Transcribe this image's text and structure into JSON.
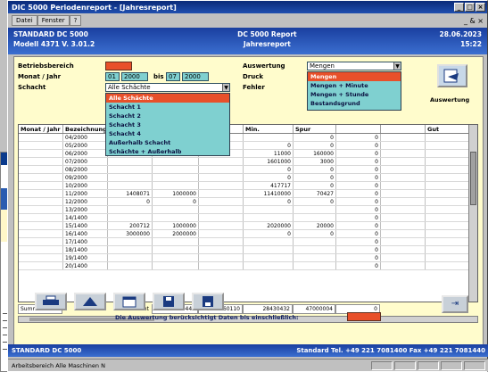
{
  "window": {
    "title": "DIC 5000 Periodenreport - [Jahresreport]",
    "controls": [
      "_",
      "□",
      "×"
    ]
  },
  "menu": {
    "items": [
      "Datei",
      "Fenster",
      "?"
    ],
    "right_label": "_ & ×"
  },
  "header": {
    "left_line1": "STANDARD DC 5000",
    "left_line2": "Modell 4371 V. 3.01.2",
    "center_line1": "DC 5000 Report",
    "center_line2": "Jahresreport",
    "right_line1": "28.06.2023",
    "right_line2": "15:22"
  },
  "form": {
    "label_betriebsbereich": "Betriebsbereich",
    "label_monat_jahr": "Monat / Jahr",
    "monat_von": "01",
    "jahr_von": "2000",
    "label_bis": "bis",
    "monat_bis": "07",
    "jahr_bis": "2000",
    "label_schacht": "Schacht",
    "schacht_value": "Alle Schächte",
    "label_auswertung": "Auswertung",
    "auswertung_value": "Mengen",
    "label_druck": "Druck",
    "label_fehler": "Fehler",
    "auswertung_button_label": "Auswertung"
  },
  "schacht_dropdown": {
    "options": [
      "Alle Schächte",
      "Schacht 1",
      "Schacht 2",
      "Schacht 3",
      "Schacht 4",
      "Außerhalb Schacht",
      "Schächte + Außerhalb"
    ],
    "selected_index": 0
  },
  "auswertung_dropdown": {
    "options": [
      "Mengen",
      "Mengen + Minute",
      "Mengen + Stunde",
      "Bestandsgrund"
    ],
    "selected_index": 0
  },
  "table": {
    "headers": [
      "Monat / Jahr",
      "Bezeichnung",
      "",
      "",
      "",
      "Min.",
      "Spur",
      "",
      "",
      "Gut"
    ],
    "rows": [
      [
        "",
        "04/2000",
        "",
        "",
        "",
        "",
        "0",
        "0",
        "",
        ""
      ],
      [
        "",
        "05/2000",
        "",
        "",
        "",
        "0",
        "0",
        "0",
        "",
        ""
      ],
      [
        "",
        "06/2000",
        "",
        "",
        "",
        "11000",
        "160000",
        "0",
        "",
        ""
      ],
      [
        "",
        "07/2000",
        "",
        "",
        "",
        "1601000",
        "3000",
        "0",
        "",
        ""
      ],
      [
        "",
        "08/2000",
        "",
        "",
        "",
        "0",
        "0",
        "0",
        "",
        ""
      ],
      [
        "",
        "09/2000",
        "",
        "",
        "",
        "0",
        "0",
        "0",
        "",
        ""
      ],
      [
        "",
        "10/2000",
        "",
        "",
        "",
        "417717",
        "0",
        "0",
        "",
        ""
      ],
      [
        "",
        "11/2000",
        "1408071",
        "1000000",
        "",
        "11410000",
        "70427",
        "0",
        "",
        ""
      ],
      [
        "",
        "12/2000",
        "0",
        "0",
        "",
        "0",
        "0",
        "0",
        "",
        ""
      ],
      [
        "",
        "13/2000",
        "",
        "",
        "",
        "",
        "",
        "0",
        "",
        ""
      ],
      [
        "",
        "14/1400",
        "",
        "",
        "",
        "",
        "",
        "0",
        "",
        ""
      ],
      [
        "",
        "15/1400",
        "200712",
        "1000000",
        "",
        "2020000",
        "20000",
        "0",
        "",
        ""
      ],
      [
        "",
        "16/1400",
        "3000000",
        "2000000",
        "",
        "0",
        "0",
        "0",
        "",
        ""
      ],
      [
        "",
        "17/1400",
        "",
        "",
        "",
        "",
        "",
        "0",
        "",
        ""
      ],
      [
        "",
        "18/1400",
        "",
        "",
        "",
        "",
        "",
        "0",
        "",
        ""
      ],
      [
        "",
        "19/1400",
        "",
        "",
        "",
        "",
        "",
        "0",
        "",
        ""
      ],
      [
        "",
        "20/1400",
        "",
        "",
        "",
        "",
        "",
        "0",
        "",
        ""
      ]
    ]
  },
  "summary": {
    "label": "Summen: 03",
    "label2": "Gesamt",
    "v1": "15750441",
    "v2": "26460110",
    "v3": "28430432",
    "v4": "47000004",
    "v5": "0"
  },
  "toolbar": {
    "buttons": [
      "print-icon",
      "chart-icon",
      "calendar-icon",
      "save-icon",
      "disk-icon"
    ],
    "exit_label": "⇥"
  },
  "hint": {
    "text": "Die Auswertung berücksichtigt Daten bis einschließlich:"
  },
  "footer": {
    "left": "STANDARD DC 5000",
    "right": "Standard Tel. +49 221 7081400   Fax +49 221 7081440"
  },
  "statusbar": {
    "text": "Arbeitsbereich Alle Maschinen N"
  },
  "colors": {
    "accent_red": "#e8502a",
    "field_cyan": "#7fd0d0",
    "panel_yellow": "#fffccc",
    "header_blue": "#1a3fa0"
  }
}
